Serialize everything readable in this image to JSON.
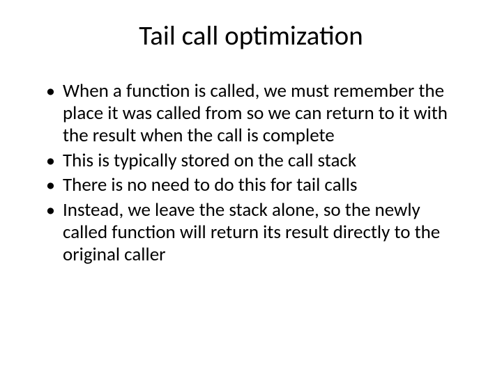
{
  "slide": {
    "title": "Tail call optimization",
    "bullets": [
      "When a function is called, we must remember the place it was called from so we can return to it with the result when the call is complete",
      "This is typically stored on the call stack",
      "There is no need to do this for tail calls",
      "Instead, we leave the stack alone, so the newly called function will return its result directly to the original caller"
    ]
  }
}
